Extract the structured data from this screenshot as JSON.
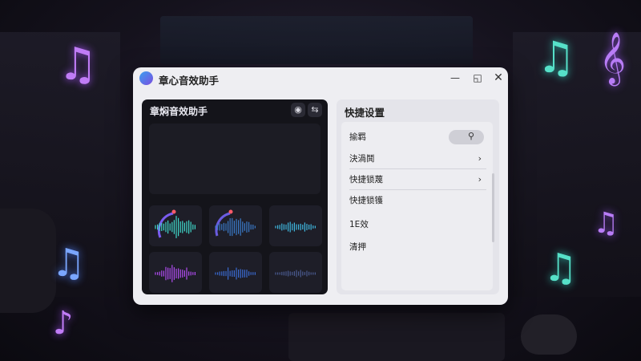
{
  "window": {
    "title": "章心音效助手",
    "controls": [
      "minimize",
      "maximize",
      "close"
    ]
  },
  "left_panel": {
    "title": "章焖音效助手",
    "icons": [
      "record-icon",
      "swap-icon"
    ],
    "thumbnails": 6
  },
  "right_panel": {
    "title": "快捷设置",
    "search_label": "揄羁",
    "items": [
      {
        "label": "決渦鬨",
        "has_chevron": true
      },
      {
        "label": "快捷锁蔑",
        "has_chevron": true
      },
      {
        "label": "快捷锁镬",
        "has_chevron": false
      },
      {
        "label": "1E效",
        "has_chevron": false
      },
      {
        "label": "清押",
        "has_chevron": false
      }
    ]
  },
  "colors": {
    "accent_purple": "#a45cf0",
    "accent_teal": "#3fd6c8",
    "accent_blue": "#4f8cf0",
    "window_bg": "#eeeef2",
    "dark_panel": "#14141a"
  }
}
